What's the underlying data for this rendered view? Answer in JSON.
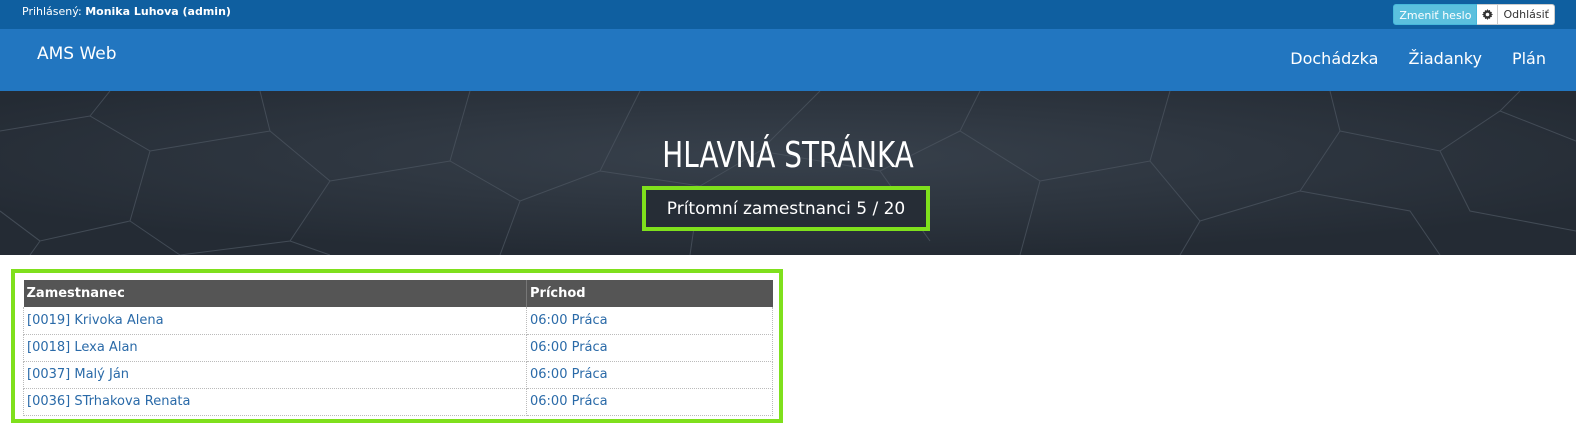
{
  "topbar": {
    "login_prefix": "Prihlásený:",
    "user_name": "Monika Luhova (admin)",
    "change_password_label": "Zmeniť heslo",
    "settings_icon": "gear-icon",
    "logout_label": "Odhlásiť"
  },
  "navbar": {
    "brand": "AMS Web",
    "items": [
      {
        "label": "Dochádzka"
      },
      {
        "label": "Žiadanky"
      },
      {
        "label": "Plán"
      }
    ]
  },
  "hero": {
    "title": "HLAVNÁ STRÁNKA",
    "present_text": "Prítomní zamestnanci 5 / 20"
  },
  "table": {
    "headers": [
      "Zamestnanec",
      "Príchod"
    ],
    "rows": [
      [
        "[0019] Krivoka Alena",
        "06:00 Práca"
      ],
      [
        "[0018] Lexa Alan",
        "06:00 Práca"
      ],
      [
        "[0037] Malý Ján",
        "06:00 Práca"
      ],
      [
        "[0036] STrhakova Renata",
        "06:00 Práca"
      ]
    ]
  },
  "colors": {
    "topbar": "#0f5fa0",
    "navbar": "#2276c0",
    "hero": "#2a323c",
    "highlight": "#7fe01c",
    "link": "#2a6aa8",
    "table_header": "#555555"
  }
}
